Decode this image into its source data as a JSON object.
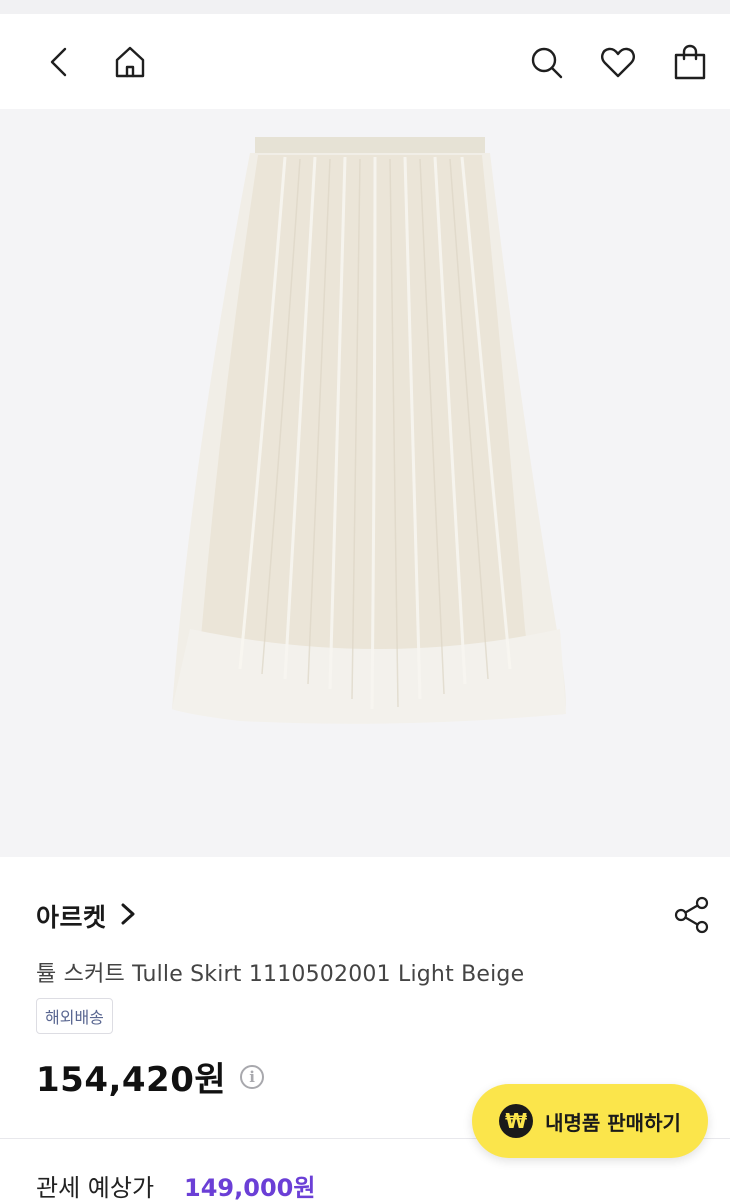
{
  "header": {
    "back_icon": "chevron-left-icon",
    "home_icon": "home-icon",
    "search_icon": "search-icon",
    "wishlist_icon": "heart-icon",
    "cart_icon": "shopping-bag-icon"
  },
  "hero": {
    "background_color": "#f4f4f6",
    "product_color": "#efeadf"
  },
  "product": {
    "brand": "아르켓",
    "brand_chevron_icon": "chevron-right-icon",
    "share_icon": "share-icon",
    "title": "튤 스커트 Tulle Skirt 1110502001 Light Beige",
    "badge": "해외배송",
    "price": "154,420원",
    "price_info_symbol": "i"
  },
  "floating_button": {
    "icon": "₩",
    "label": "내명품 판매하기",
    "color": "#fbe54b"
  },
  "bottom_peek": {
    "label": "관세 예상가",
    "value": "149,000원",
    "accent_color": "#6b3fd6"
  }
}
